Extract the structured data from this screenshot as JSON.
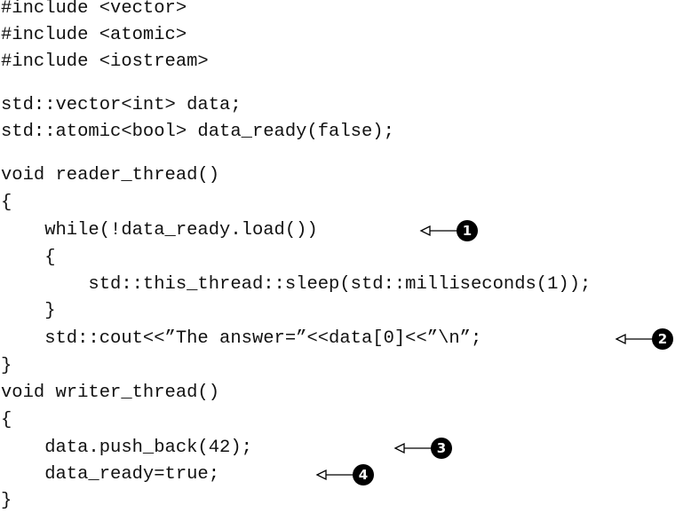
{
  "code": {
    "lines": [
      "#include <vector>",
      "#include <atomic>",
      "#include <iostream>",
      "",
      "std::vector<int> data;",
      "std::atomic<bool> data_ready(false);",
      "",
      "void reader_thread()",
      "{",
      "    while(!data_ready.load())",
      "    {",
      "        std::this_thread::sleep(std::milliseconds(1));",
      "    }",
      "    std::cout<<”The answer=”<<data[0]<<”\\n”;",
      "}",
      "void writer_thread()",
      "{",
      "    data.push_back(42);",
      "    data_ready=true;",
      "}"
    ]
  },
  "callouts": [
    {
      "number": "1"
    },
    {
      "number": "2"
    },
    {
      "number": "3"
    },
    {
      "number": "4"
    }
  ],
  "colors": {
    "text": "#111111",
    "marker": "#000000",
    "background": "#ffffff"
  }
}
